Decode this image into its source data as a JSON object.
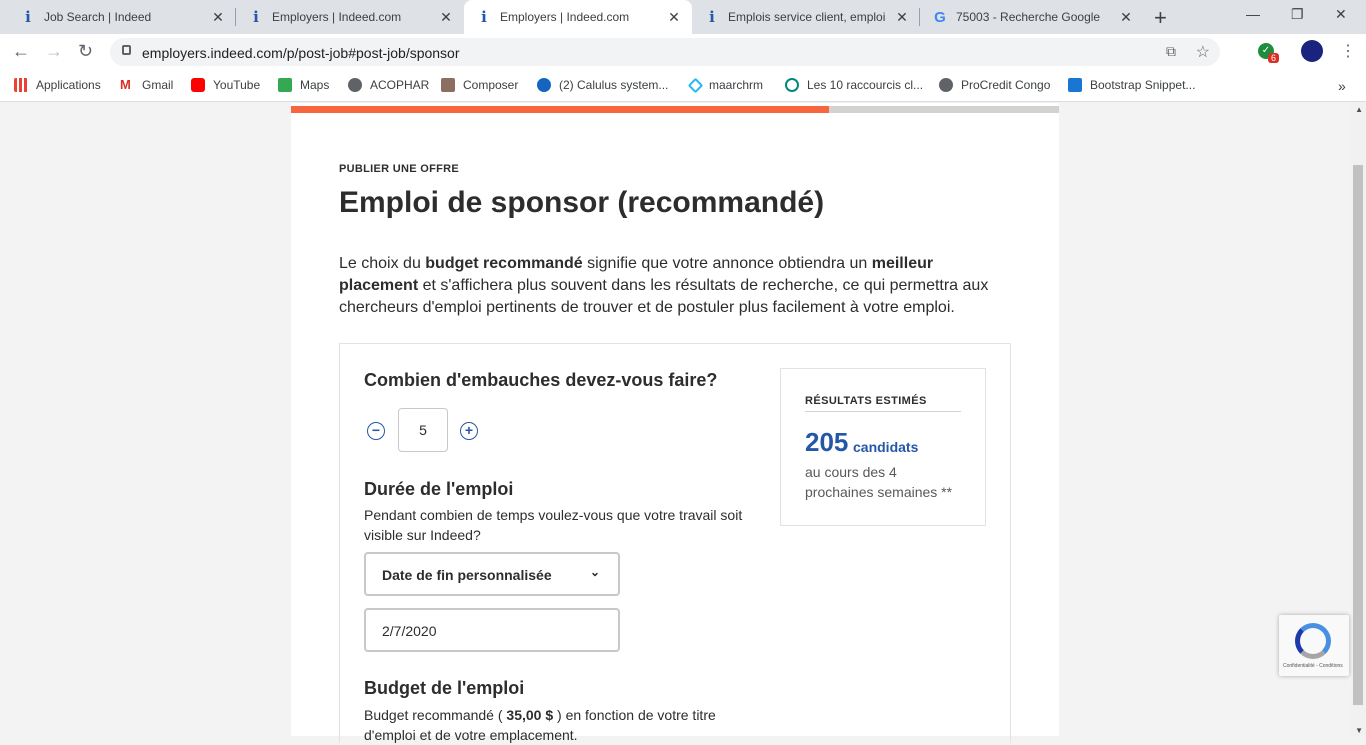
{
  "tabs": [
    {
      "title": "Job Search | Indeed",
      "icon": "indeed-icon"
    },
    {
      "title": "Employers | Indeed.com",
      "icon": "indeed-icon"
    },
    {
      "title": "Employers | Indeed.com",
      "icon": "indeed-icon",
      "active": true
    },
    {
      "title": "Emplois service client, emploi",
      "icon": "indeed-icon"
    },
    {
      "title": "75003 - Recherche Google",
      "icon": "google-icon"
    }
  ],
  "address": {
    "url": "employers.indeed.com/p/post-job#post-job/sponsor"
  },
  "bookmarks": [
    "Applications",
    "Gmail",
    "YouTube",
    "Maps",
    "ACOPHAR",
    "Composer",
    "(2) Calulus system...",
    "maarchrm",
    "Les 10 raccourcis cl...",
    "ProCredit Congo",
    "Bootstrap Snippet..."
  ],
  "extension_badge": "6",
  "progress": 0.7,
  "page": {
    "eyebrow": "PUBLIER UNE OFFRE",
    "title": "Emploi de sponsor (recommandé)",
    "intro_1": "Le choix du ",
    "intro_b1": "budget recommandé",
    "intro_2": " signifie que votre annonce obtiendra un ",
    "intro_b2": "meilleur placement",
    "intro_3": " et s'affichera plus souvent dans les résultats de recherche, ce qui permettra aux chercheurs d'emploi pertinents de trouver et de postuler plus facilement à votre emploi."
  },
  "hires": {
    "question": "Combien d'embauches devez-vous faire?",
    "value": "5"
  },
  "duration": {
    "title": "Durée de l'emploi",
    "help": "Pendant combien de temps voulez-vous que votre travail soit visible sur Indeed?",
    "select": "Date de fin personnalisée",
    "date": "2/7/2020"
  },
  "budget": {
    "title": "Budget de l'emploi",
    "help_1": "Budget recommandé ( ",
    "amount": "35,00 $",
    "help_2": " ) en fonction de votre titre d'emploi et de votre emplacement."
  },
  "results": {
    "title": "RÉSULTATS ESTIMÉS",
    "count": "205",
    "unit": "candidats",
    "desc": "au cours des 4 prochaines semaines **"
  },
  "recaptcha": {
    "caption": "Confidentialité - Conditions"
  }
}
